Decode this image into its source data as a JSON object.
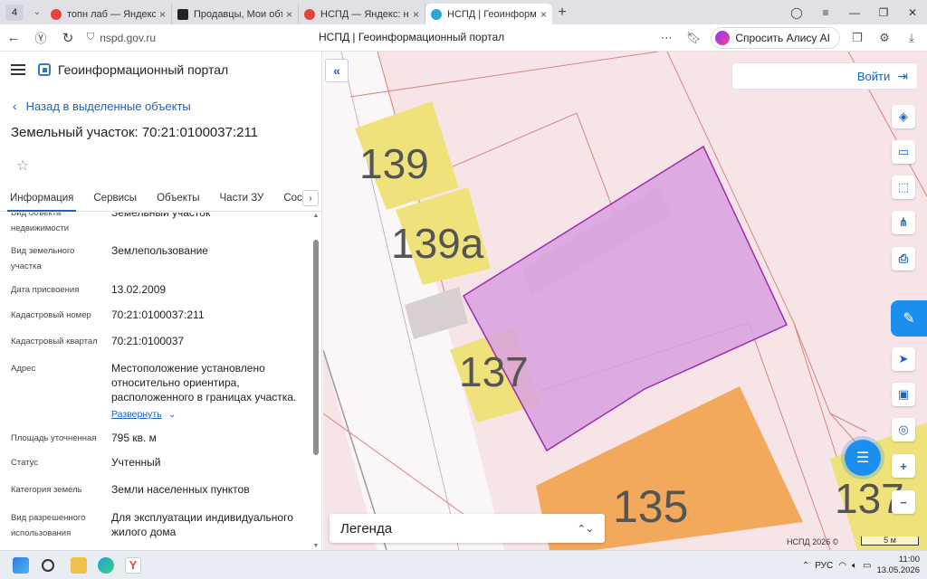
{
  "browser": {
    "tab_count": "4",
    "tabs": [
      {
        "title": "топн лаб — Яндекс: нашло",
        "color": "#e8433c",
        "active": false
      },
      {
        "title": "Продавцы, Мои объекты",
        "color": "#222222",
        "active": false
      },
      {
        "title": "НСПД — Яндекс: нашлось",
        "color": "#e8433c",
        "active": false
      },
      {
        "title": "НСПД | Геоинформационный",
        "color": "#2aa6d6",
        "active": true
      }
    ],
    "url": "nspd.gov.ru",
    "page_title": "НСПД | Геоинформационный портал",
    "alice_label": "Спросить Алису AI"
  },
  "panel": {
    "portal_name": "Геоинформационный портал",
    "back_label": "Назад в выделенные объекты",
    "object_title": "Земельный участок: 70:21:0100037:211",
    "tabs": [
      "Информация",
      "Сервисы",
      "Объекты",
      "Части ЗУ",
      "Состав"
    ],
    "properties": [
      {
        "key": "Вид объекта недвижимости",
        "value": "Земельный участок"
      },
      {
        "key": "Вид земельного участка",
        "value": "Землепользование"
      },
      {
        "key": "Дата присвоения",
        "value": "13.02.2009"
      },
      {
        "key": "Кадастровый номер",
        "value": "70:21:0100037:211"
      },
      {
        "key": "Кадастровый квартал",
        "value": "70:21:0100037"
      },
      {
        "key": "Адрес",
        "value": "Местоположение установлено относительно ориентира, расположенного в границах участка."
      },
      {
        "key": "Площадь уточненная",
        "value": "795 кв. м"
      },
      {
        "key": "Статус",
        "value": "Учтенный"
      },
      {
        "key": "Категория земель",
        "value": "Земли населенных пунктов"
      },
      {
        "key": "Вид разрешенного использования",
        "value": "Для эксплуатации индивидуального жилого дома"
      }
    ],
    "expand_label": "Развернуть"
  },
  "map": {
    "login_label": "Войти",
    "legend_label": "Легенда",
    "copyright": "НСПД 2026 ©",
    "scale_label": "5 м",
    "labels": [
      "139",
      "139а",
      "137",
      "135",
      "137"
    ],
    "colors": {
      "parcel_fill": "#d9a0e0",
      "parcel_stroke": "#a12ab0",
      "building_yellow": "#efe27a",
      "building_orange": "#f2a95c",
      "boundary": "#d9847e"
    }
  },
  "taskbar": {
    "lang": "РУС",
    "time": "11:00",
    "date": "13.05.2026"
  }
}
